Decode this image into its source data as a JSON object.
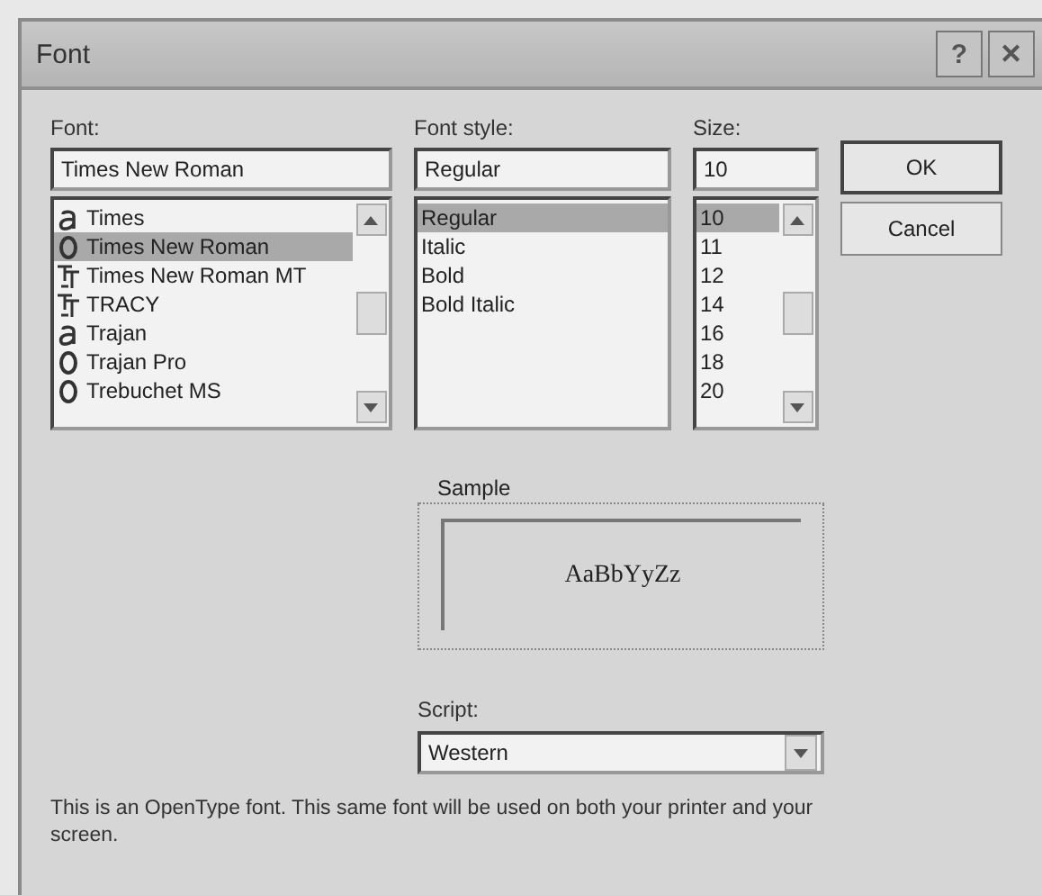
{
  "window": {
    "title": "Font",
    "title_buttons": [
      "?",
      "✕"
    ]
  },
  "font": {
    "label": "Font:",
    "value": "Times New Roman",
    "items": [
      {
        "name": "Times",
        "kind": "type1",
        "selected": false
      },
      {
        "name": "Times New Roman",
        "kind": "opentype",
        "selected": true
      },
      {
        "name": "Times New Roman MT",
        "kind": "truetype",
        "selected": false
      },
      {
        "name": "TRACY",
        "kind": "truetype",
        "selected": false
      },
      {
        "name": "Trajan",
        "kind": "type1",
        "selected": false
      },
      {
        "name": "Trajan Pro",
        "kind": "opentype",
        "selected": false
      },
      {
        "name": "Trebuchet MS",
        "kind": "opentype",
        "selected": false
      }
    ]
  },
  "font_style": {
    "label": "Font style:",
    "value": "Regular",
    "items": [
      {
        "name": "Regular",
        "selected": true
      },
      {
        "name": "Italic",
        "selected": false
      },
      {
        "name": "Bold",
        "selected": false
      },
      {
        "name": "Bold Italic",
        "selected": false
      }
    ]
  },
  "size": {
    "label": "Size:",
    "value": "10",
    "items": [
      {
        "name": "10",
        "selected": true
      },
      {
        "name": "11",
        "selected": false
      },
      {
        "name": "12",
        "selected": false
      },
      {
        "name": "14",
        "selected": false
      },
      {
        "name": "16",
        "selected": false
      },
      {
        "name": "18",
        "selected": false
      },
      {
        "name": "20",
        "selected": false
      }
    ]
  },
  "buttons": [
    {
      "label": "OK",
      "default": true
    },
    {
      "label": "Cancel",
      "default": false
    }
  ],
  "sample": {
    "label": "Sample",
    "text": "AaBbYyZz"
  },
  "script": {
    "label": "Script:",
    "value": "Western"
  },
  "description": "This is an OpenType font. This same font will be used on both your printer and your screen."
}
